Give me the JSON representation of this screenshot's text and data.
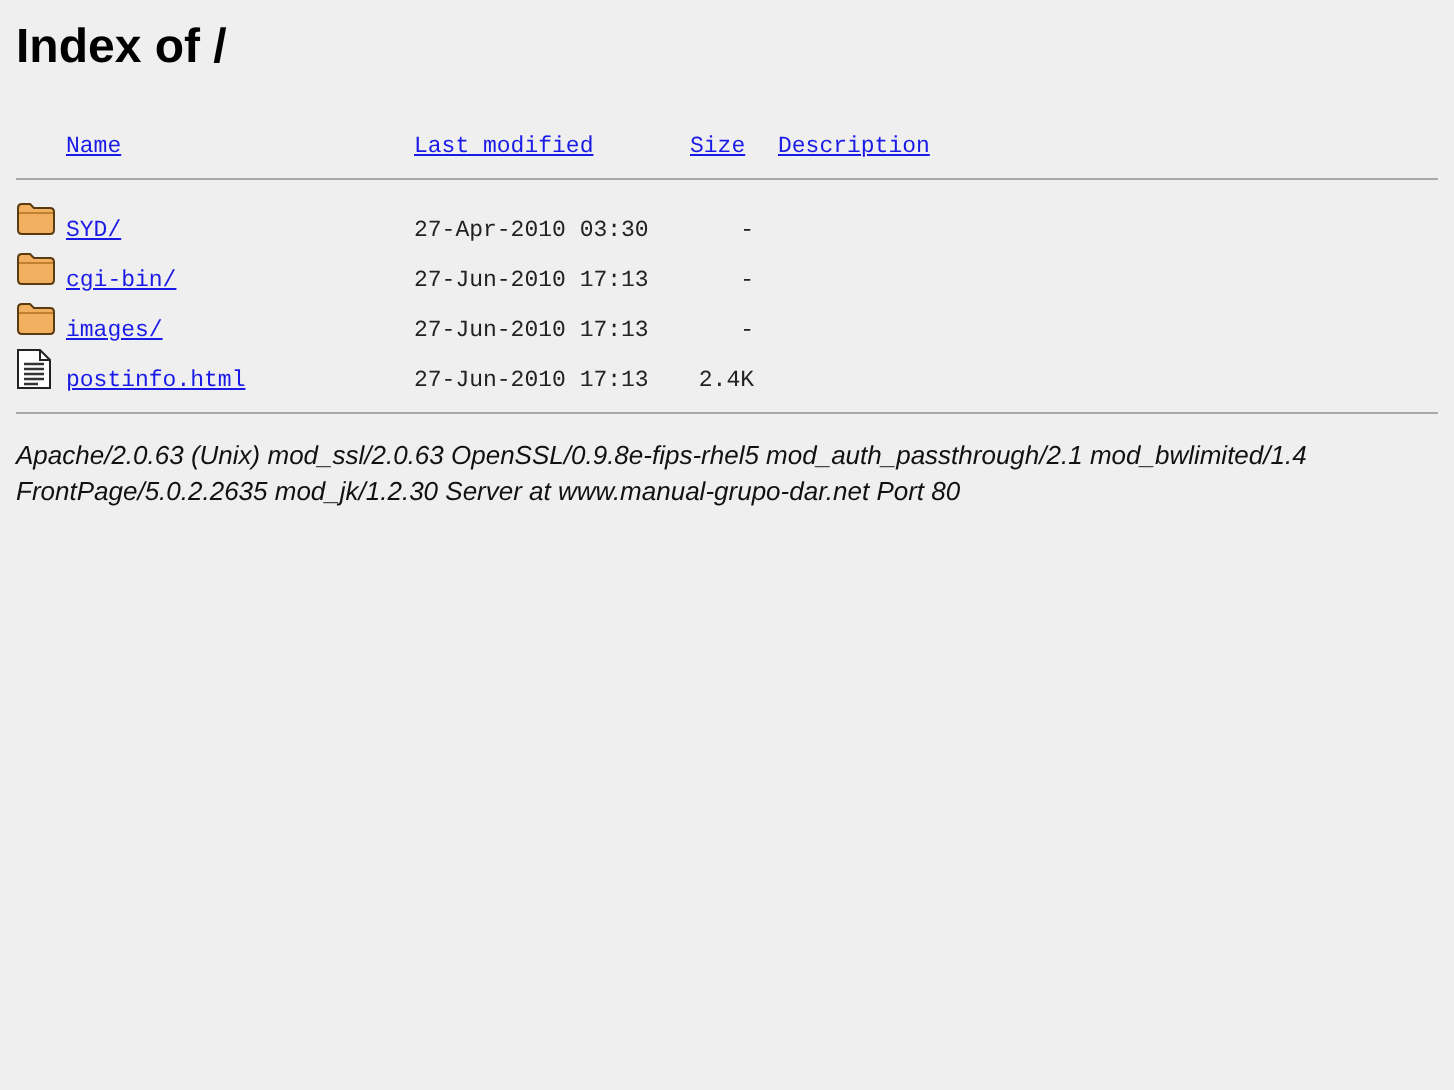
{
  "title": "Index of /",
  "columns": [
    "Name",
    "Last modified",
    "Size",
    "Description"
  ],
  "entries": [
    {
      "kind": "folder",
      "name": "SYD/",
      "modified": "27-Apr-2010 03:30",
      "size": "-"
    },
    {
      "kind": "folder",
      "name": "cgi-bin/",
      "modified": "27-Jun-2010 17:13",
      "size": "-"
    },
    {
      "kind": "folder",
      "name": "images/",
      "modified": "27-Jun-2010 17:13",
      "size": "-"
    },
    {
      "kind": "file",
      "name": "postinfo.html",
      "modified": "27-Jun-2010 17:13",
      "size": "2.4K"
    }
  ],
  "footer": [
    "Apache/2.0.63 (Unix) mod_ssl/2.0.63 OpenSSL/0.9.8e-fips-rhel5 mod_auth_passthrough/2.1 mod_bwlimited/1.4",
    "FrontPage/5.0.2.2635 mod_jk/1.2.30 Server at www.manual-grupo-dar.net Port 80"
  ]
}
